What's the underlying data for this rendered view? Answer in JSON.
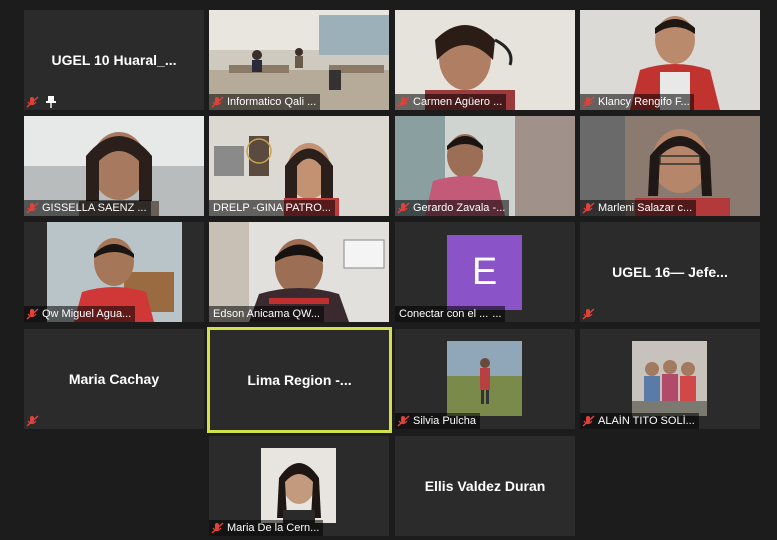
{
  "tiles": [
    {
      "name": "UGEL 10 Huaral_..."
    },
    {
      "name": "Informatico Qali ..."
    },
    {
      "name": "Carmen Agüero ..."
    },
    {
      "name": "Klancy Rengifo F..."
    },
    {
      "name": "GISSELLA SAENZ ..."
    },
    {
      "name": "DRELP -GINA PATRO..."
    },
    {
      "name": "Gerardo Zavala -..."
    },
    {
      "name": "Marleni Salazar c..."
    },
    {
      "name": "Qw Miguel Agua..."
    },
    {
      "name": "Edson Anicama QW..."
    },
    {
      "name": "Conectar con el ...",
      "avatar_letter": "E",
      "more": "..."
    },
    {
      "name": "UGEL 16— Jefe..."
    },
    {
      "name": "Maria Cachay"
    },
    {
      "name": "Lima Region -..."
    },
    {
      "name": "Silvia Pulcha"
    },
    {
      "name": "ALAÍN TITO SOLÍ..."
    },
    {
      "name": "Maria De la Cern..."
    },
    {
      "name": "Ellis Valdez Duran"
    }
  ],
  "colors": {
    "muted_icon": "#e0423a",
    "active_border": "#d4e04a",
    "avatar_bg": "#8a54c8"
  }
}
